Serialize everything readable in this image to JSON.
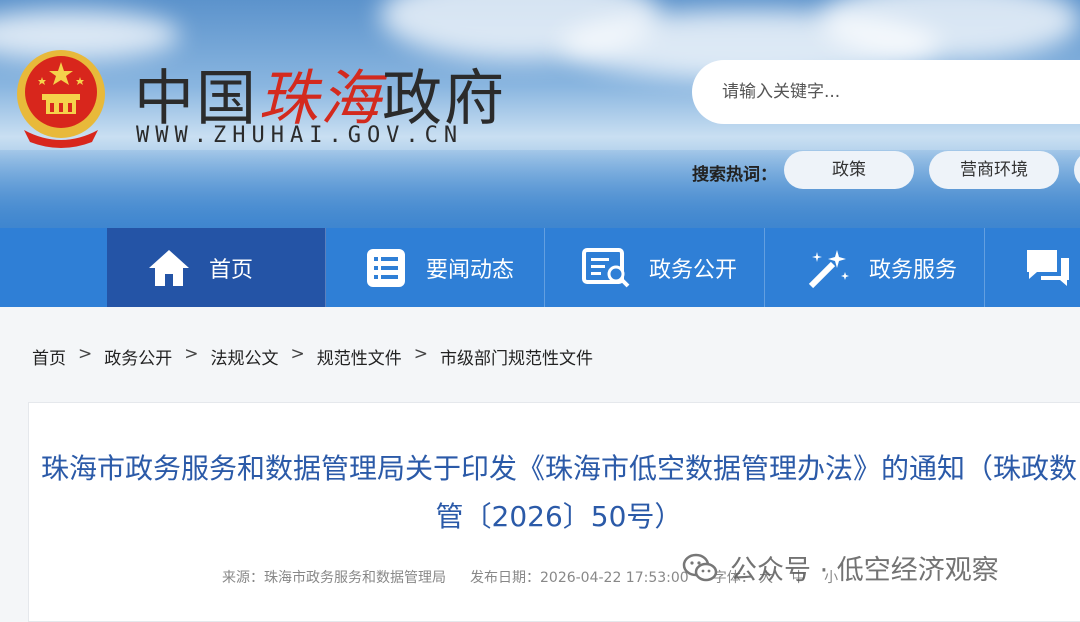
{
  "header": {
    "site_title_prefix": "中国",
    "site_title_highlight": "珠海",
    "site_title_suffix": "政府",
    "site_url": "WWW.ZHUHAI.GOV.CN",
    "search_placeholder": "请输入关键字...",
    "hot_label": "搜索热词：",
    "hot_tags": [
      "政策",
      "营商环境"
    ]
  },
  "nav": {
    "items": [
      {
        "label": "首页",
        "icon": "home-icon",
        "active": true
      },
      {
        "label": "要闻动态",
        "icon": "news-list-icon"
      },
      {
        "label": "政务公开",
        "icon": "document-search-icon"
      },
      {
        "label": "政务服务",
        "icon": "magic-wand-icon"
      },
      {
        "label": "",
        "icon": "chat-icon"
      }
    ],
    "colors": {
      "bar": "#2f7fd6",
      "active": "#2454a6"
    }
  },
  "breadcrumb": [
    "首页",
    "政务公开",
    "法规公文",
    "规范性文件",
    "市级部门规范性文件"
  ],
  "breadcrumb_separator": ">",
  "article": {
    "title": "珠海市政务服务和数据管理局关于印发《珠海市低空数据管理办法》的通知（珠政数管〔2026〕50号）",
    "source_label": "来源：",
    "source": "珠海市政务服务和数据管理局",
    "date_label": "发布日期：",
    "date": "2026-04-22 17:53:00",
    "font_label": "字体：",
    "font_options": [
      "大",
      "中",
      "小"
    ],
    "title_color": "#2b5aa8"
  },
  "watermark": {
    "text": "公众号 · 低空经济观察",
    "icon": "wechat-icon"
  }
}
